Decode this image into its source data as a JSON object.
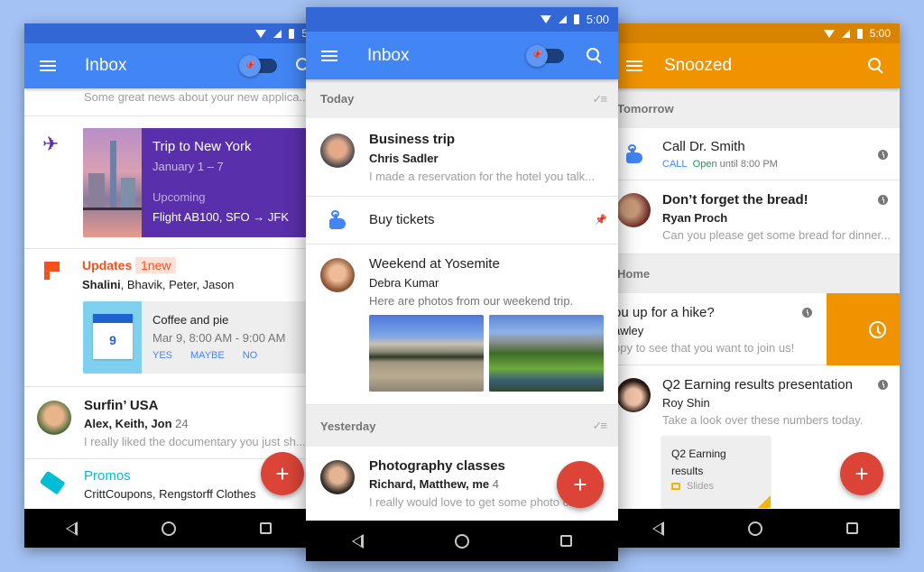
{
  "left_phone": {
    "status_time": "5:0",
    "appbar_title": "Inbox",
    "top_snippet": "Some great news about your new applica...",
    "trip": {
      "title": "Trip to New York",
      "dates": "January 1 – 7",
      "status": "Upcoming",
      "flight": "Flight AB100,  SFO → JFK"
    },
    "updates": {
      "label": "Updates",
      "badge": "1new",
      "senders_bold": "Shalini",
      "senders_rest": ", Bhavik, Peter, Jason",
      "event_title": "Coffee and pie",
      "event_time": "Mar 9, 8:00 AM - 9:00 AM",
      "calendar_day": "9",
      "rsvp": [
        "YES",
        "MAYBE",
        "NO"
      ]
    },
    "surfin": {
      "subject": "Surfin’ USA",
      "senders": "Alex, Keith, Jon",
      "count": "24",
      "snippet": "I really liked the documentary you just sh..."
    },
    "promos": {
      "label": "Promos",
      "senders": "CrittCoupons, Rengstorff Clothes"
    },
    "fab_symbol": "+"
  },
  "mid_phone": {
    "status_time": "5:00",
    "appbar_title": "Inbox",
    "sections": {
      "today": "Today",
      "yesterday": "Yesterday"
    },
    "business": {
      "subject": "Business trip",
      "sender": "Chris Sadler",
      "snippet": "I made a reservation for the hotel you talk..."
    },
    "reminder": {
      "text": "Buy tickets"
    },
    "yosemite": {
      "subject": "Weekend at Yosemite",
      "sender": "Debra Kumar",
      "snippet": "Here are photos from our weekend trip."
    },
    "photography": {
      "subject": "Photography classes",
      "senders": "Richard, Matthew, me",
      "count": "4",
      "snippet": "I really would love to get some photo cla..."
    },
    "fab_symbol": "+",
    "sweep_symbol": "✓≡"
  },
  "right_phone": {
    "status_time": "5:00",
    "appbar_title": "Snoozed",
    "sections": {
      "tomorrow": "Tomorrow",
      "home": "Home"
    },
    "call": {
      "title": "Call Dr. Smith",
      "action": "CALL",
      "open": "Open",
      "until": "until 8:00 PM"
    },
    "bread": {
      "subject": "Don’t forget the bread!",
      "sender": "Ryan Proch",
      "snippet": "Can you please get some bread for dinner..."
    },
    "hike": {
      "subject": "ou up for a hike?",
      "sender": "awley",
      "snippet": "ppy to see that you want to join us!"
    },
    "q2": {
      "subject": "Q2 Earning results presentation",
      "sender": "Roy Shin",
      "snippet": "Take a look over these numbers today.",
      "attachment_title": "Q2 Earning results",
      "attachment_type": "Slides"
    },
    "fab_symbol": "+"
  },
  "colors": {
    "inbox_blue": "#4285f4",
    "inbox_status": "#3367d6",
    "snooze_orange": "#f09300",
    "snooze_status": "#d88400",
    "trip_purple": "#5a2fab",
    "updates_orange": "#f4511e",
    "promos_cyan": "#00bcd4",
    "fab_red": "#db4437"
  }
}
